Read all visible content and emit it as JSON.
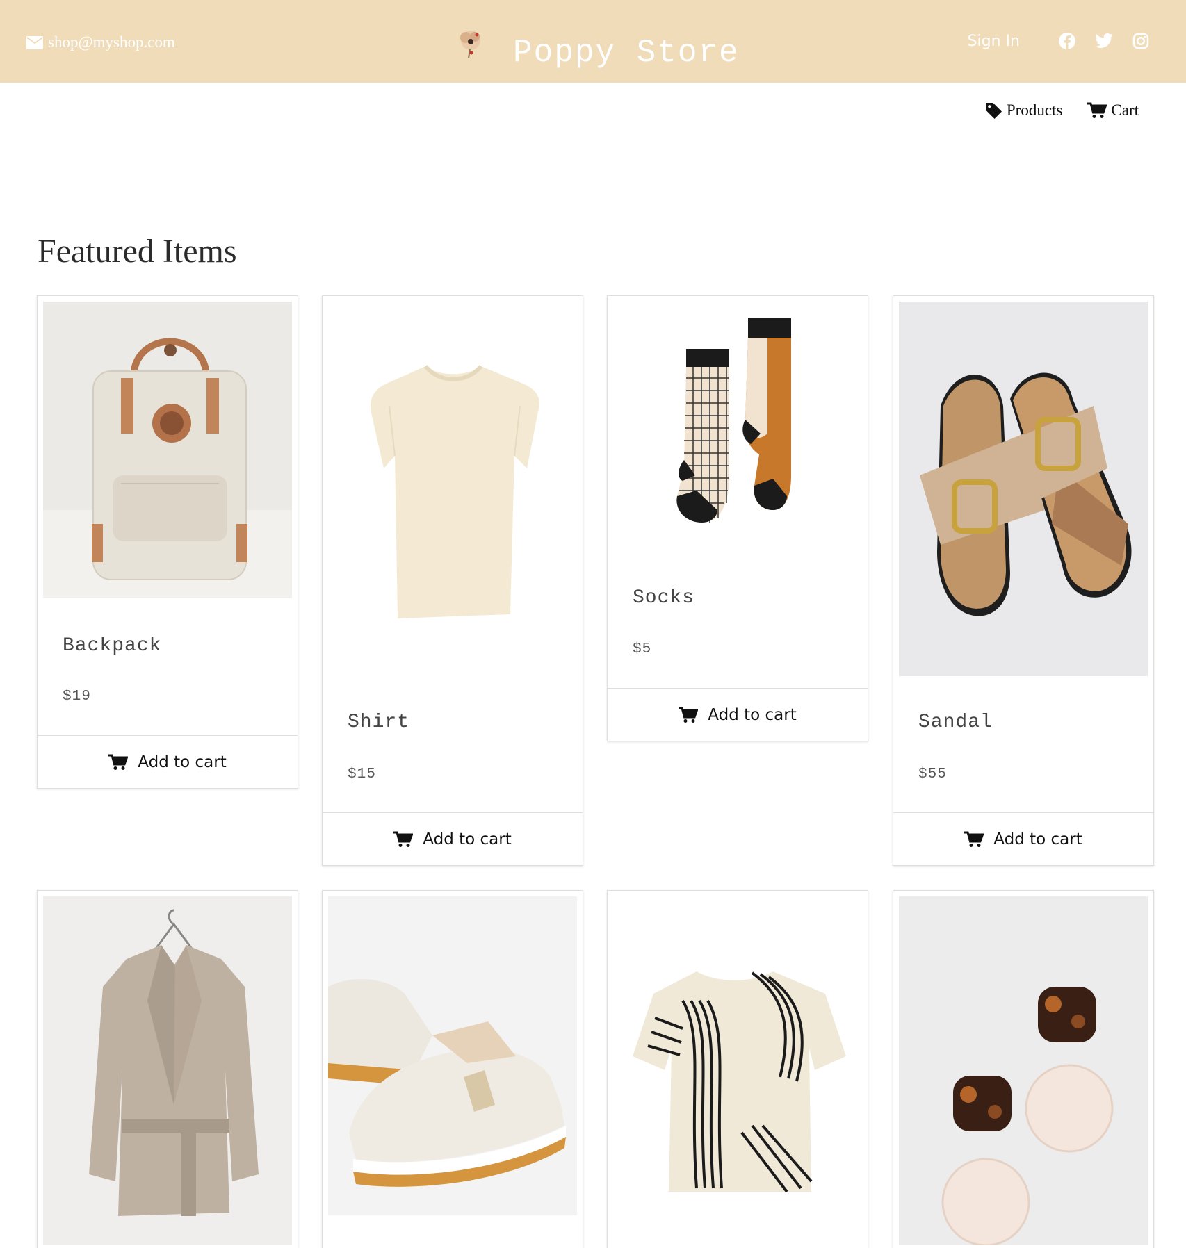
{
  "header": {
    "email": "shop@myshop.com",
    "brand": "Poppy Store",
    "sign_in": "Sign In",
    "social": [
      "facebook-icon",
      "twitter-icon",
      "instagram-icon"
    ]
  },
  "nav": {
    "products": "Products",
    "cart": "Cart"
  },
  "section_title": "Featured Items",
  "add_to_cart": "Add to cart",
  "products": [
    {
      "name": "Backpack",
      "price": "$19"
    },
    {
      "name": "Shirt",
      "price": "$15"
    },
    {
      "name": "Socks",
      "price": "$5"
    },
    {
      "name": "Sandal",
      "price": "$55"
    }
  ],
  "colors": {
    "topbar": "#f0dcb9",
    "header_text": "#ffffff",
    "card_border": "#dedede"
  }
}
